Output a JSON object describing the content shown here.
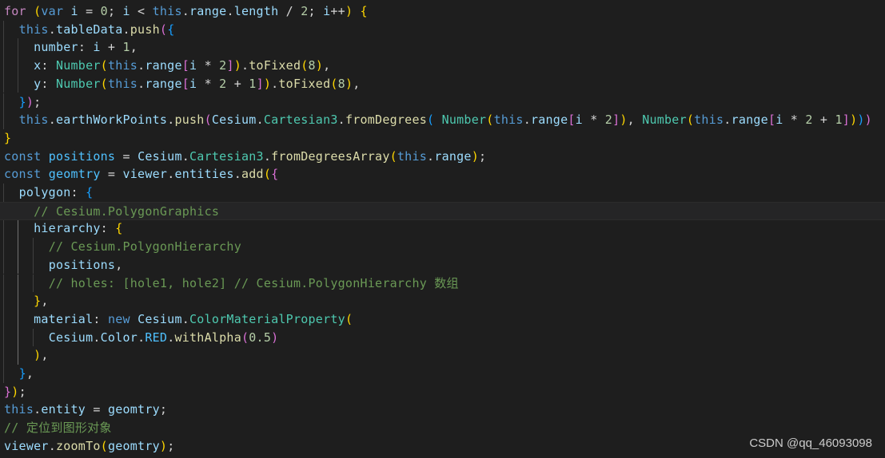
{
  "lines": [
    [
      [
        "for",
        "t-ctrl"
      ],
      [
        " ",
        "t-p"
      ],
      [
        "(",
        "t-b1"
      ],
      [
        "var",
        "t-decl"
      ],
      [
        " ",
        "t-p"
      ],
      [
        "i",
        "t-var"
      ],
      [
        " = ",
        "t-p"
      ],
      [
        "0",
        "t-num"
      ],
      [
        "; ",
        "t-p"
      ],
      [
        "i",
        "t-var"
      ],
      [
        " < ",
        "t-p"
      ],
      [
        "this",
        "t-this"
      ],
      [
        ".",
        "t-p"
      ],
      [
        "range",
        "t-var"
      ],
      [
        ".",
        "t-p"
      ],
      [
        "length",
        "t-var"
      ],
      [
        " / ",
        "t-p"
      ],
      [
        "2",
        "t-num"
      ],
      [
        "; ",
        "t-p"
      ],
      [
        "i",
        "t-var"
      ],
      [
        "++",
        "t-p"
      ],
      [
        ")",
        "t-b1"
      ],
      [
        " ",
        "t-p"
      ],
      [
        "{",
        "t-b1"
      ]
    ],
    [
      [
        "  ",
        "t-p"
      ],
      [
        "this",
        "t-this"
      ],
      [
        ".",
        "t-p"
      ],
      [
        "tableData",
        "t-var"
      ],
      [
        ".",
        "t-p"
      ],
      [
        "push",
        "t-fn"
      ],
      [
        "(",
        "t-b2"
      ],
      [
        "{",
        "t-b3"
      ]
    ],
    [
      [
        "    ",
        "t-p"
      ],
      [
        "number",
        "t-prop"
      ],
      [
        ": ",
        "t-p"
      ],
      [
        "i",
        "t-var"
      ],
      [
        " + ",
        "t-p"
      ],
      [
        "1",
        "t-num"
      ],
      [
        ",",
        "t-p"
      ]
    ],
    [
      [
        "    ",
        "t-p"
      ],
      [
        "x",
        "t-prop"
      ],
      [
        ": ",
        "t-p"
      ],
      [
        "Number",
        "t-cls"
      ],
      [
        "(",
        "t-b1"
      ],
      [
        "this",
        "t-this"
      ],
      [
        ".",
        "t-p"
      ],
      [
        "range",
        "t-var"
      ],
      [
        "[",
        "t-b2"
      ],
      [
        "i",
        "t-var"
      ],
      [
        " * ",
        "t-p"
      ],
      [
        "2",
        "t-num"
      ],
      [
        "]",
        "t-b2"
      ],
      [
        ")",
        "t-b1"
      ],
      [
        ".",
        "t-p"
      ],
      [
        "toFixed",
        "t-fn"
      ],
      [
        "(",
        "t-b1"
      ],
      [
        "8",
        "t-num"
      ],
      [
        ")",
        "t-b1"
      ],
      [
        ",",
        "t-p"
      ]
    ],
    [
      [
        "    ",
        "t-p"
      ],
      [
        "y",
        "t-prop"
      ],
      [
        ": ",
        "t-p"
      ],
      [
        "Number",
        "t-cls"
      ],
      [
        "(",
        "t-b1"
      ],
      [
        "this",
        "t-this"
      ],
      [
        ".",
        "t-p"
      ],
      [
        "range",
        "t-var"
      ],
      [
        "[",
        "t-b2"
      ],
      [
        "i",
        "t-var"
      ],
      [
        " * ",
        "t-p"
      ],
      [
        "2",
        "t-num"
      ],
      [
        " + ",
        "t-p"
      ],
      [
        "1",
        "t-num"
      ],
      [
        "]",
        "t-b2"
      ],
      [
        ")",
        "t-b1"
      ],
      [
        ".",
        "t-p"
      ],
      [
        "toFixed",
        "t-fn"
      ],
      [
        "(",
        "t-b1"
      ],
      [
        "8",
        "t-num"
      ],
      [
        ")",
        "t-b1"
      ],
      [
        ",",
        "t-p"
      ]
    ],
    [
      [
        "  ",
        "t-p"
      ],
      [
        "}",
        "t-b3"
      ],
      [
        ")",
        "t-b2"
      ],
      [
        ";",
        "t-p"
      ]
    ],
    [
      [
        "  ",
        "t-p"
      ],
      [
        "this",
        "t-this"
      ],
      [
        ".",
        "t-p"
      ],
      [
        "earthWorkPoints",
        "t-var"
      ],
      [
        ".",
        "t-p"
      ],
      [
        "push",
        "t-fn"
      ],
      [
        "(",
        "t-b2"
      ],
      [
        "Cesium",
        "t-var"
      ],
      [
        ".",
        "t-p"
      ],
      [
        "Cartesian3",
        "t-cls"
      ],
      [
        ".",
        "t-p"
      ],
      [
        "fromDegrees",
        "t-fn"
      ],
      [
        "(",
        "t-b3"
      ],
      [
        " ",
        "t-p"
      ],
      [
        "Number",
        "t-cls"
      ],
      [
        "(",
        "t-b1"
      ],
      [
        "this",
        "t-this"
      ],
      [
        ".",
        "t-p"
      ],
      [
        "range",
        "t-var"
      ],
      [
        "[",
        "t-b2"
      ],
      [
        "i",
        "t-var"
      ],
      [
        " * ",
        "t-p"
      ],
      [
        "2",
        "t-num"
      ],
      [
        "]",
        "t-b2"
      ],
      [
        ")",
        "t-b1"
      ],
      [
        ", ",
        "t-p"
      ],
      [
        "Number",
        "t-cls"
      ],
      [
        "(",
        "t-b1"
      ],
      [
        "this",
        "t-this"
      ],
      [
        ".",
        "t-p"
      ],
      [
        "range",
        "t-var"
      ],
      [
        "[",
        "t-b2"
      ],
      [
        "i",
        "t-var"
      ],
      [
        " * ",
        "t-p"
      ],
      [
        "2",
        "t-num"
      ],
      [
        " + ",
        "t-p"
      ],
      [
        "1",
        "t-num"
      ],
      [
        "]",
        "t-b2"
      ],
      [
        ")",
        "t-b1"
      ],
      [
        ")",
        "t-b3"
      ],
      [
        ")",
        "t-b2"
      ]
    ],
    [
      [
        "}",
        "t-b1"
      ]
    ],
    [
      [
        "const",
        "t-decl"
      ],
      [
        " ",
        "t-p"
      ],
      [
        "positions",
        "t-const"
      ],
      [
        " = ",
        "t-p"
      ],
      [
        "Cesium",
        "t-var"
      ],
      [
        ".",
        "t-p"
      ],
      [
        "Cartesian3",
        "t-cls"
      ],
      [
        ".",
        "t-p"
      ],
      [
        "fromDegreesArray",
        "t-fn"
      ],
      [
        "(",
        "t-b1"
      ],
      [
        "this",
        "t-this"
      ],
      [
        ".",
        "t-p"
      ],
      [
        "range",
        "t-var"
      ],
      [
        ")",
        "t-b1"
      ],
      [
        ";",
        "t-p"
      ]
    ],
    [
      [
        "const",
        "t-decl"
      ],
      [
        " ",
        "t-p"
      ],
      [
        "geomtry",
        "t-const"
      ],
      [
        " = ",
        "t-p"
      ],
      [
        "viewer",
        "t-var"
      ],
      [
        ".",
        "t-p"
      ],
      [
        "entities",
        "t-var"
      ],
      [
        ".",
        "t-p"
      ],
      [
        "add",
        "t-fn"
      ],
      [
        "(",
        "t-b1"
      ],
      [
        "{",
        "t-b2"
      ]
    ],
    [
      [
        "  ",
        "t-p"
      ],
      [
        "polygon",
        "t-prop"
      ],
      [
        ": ",
        "t-p"
      ],
      [
        "{",
        "t-b3"
      ]
    ],
    [
      [
        "    ",
        "t-p"
      ],
      [
        "// Cesium.PolygonGraphics",
        "t-cmt"
      ]
    ],
    [
      [
        "    ",
        "t-p"
      ],
      [
        "hierarchy",
        "t-prop"
      ],
      [
        ": ",
        "t-p"
      ],
      [
        "{",
        "t-b1"
      ]
    ],
    [
      [
        "      ",
        "t-p"
      ],
      [
        "// Cesium.PolygonHierarchy",
        "t-cmt"
      ]
    ],
    [
      [
        "      ",
        "t-p"
      ],
      [
        "positions",
        "t-var"
      ],
      [
        ",",
        "t-p"
      ]
    ],
    [
      [
        "      ",
        "t-p"
      ],
      [
        "// holes: [hole1, hole2] // Cesium.PolygonHierarchy 数组",
        "t-cmt"
      ]
    ],
    [
      [
        "    ",
        "t-p"
      ],
      [
        "}",
        "t-b1"
      ],
      [
        ",",
        "t-p"
      ]
    ],
    [
      [
        "    ",
        "t-p"
      ],
      [
        "material",
        "t-prop"
      ],
      [
        ": ",
        "t-p"
      ],
      [
        "new",
        "t-decl"
      ],
      [
        " ",
        "t-p"
      ],
      [
        "Cesium",
        "t-var"
      ],
      [
        ".",
        "t-p"
      ],
      [
        "ColorMaterialProperty",
        "t-cls"
      ],
      [
        "(",
        "t-b1"
      ]
    ],
    [
      [
        "      ",
        "t-p"
      ],
      [
        "Cesium",
        "t-var"
      ],
      [
        ".",
        "t-p"
      ],
      [
        "Color",
        "t-var"
      ],
      [
        ".",
        "t-p"
      ],
      [
        "RED",
        "t-const"
      ],
      [
        ".",
        "t-p"
      ],
      [
        "withAlpha",
        "t-fn"
      ],
      [
        "(",
        "t-b2"
      ],
      [
        "0.5",
        "t-num"
      ],
      [
        ")",
        "t-b2"
      ]
    ],
    [
      [
        "    ",
        "t-p"
      ],
      [
        ")",
        "t-b1"
      ],
      [
        ",",
        "t-p"
      ]
    ],
    [
      [
        "  ",
        "t-p"
      ],
      [
        "}",
        "t-b3"
      ],
      [
        ",",
        "t-p"
      ]
    ],
    [
      [
        "}",
        "t-b2"
      ],
      [
        ")",
        "t-b1"
      ],
      [
        ";",
        "t-p"
      ]
    ],
    [
      [
        "this",
        "t-this"
      ],
      [
        ".",
        "t-p"
      ],
      [
        "entity",
        "t-var"
      ],
      [
        " = ",
        "t-p"
      ],
      [
        "geomtry",
        "t-var"
      ],
      [
        ";",
        "t-p"
      ]
    ],
    [
      [
        "// 定位到图形对象",
        "t-cmt"
      ]
    ],
    [
      [
        "viewer",
        "t-var"
      ],
      [
        ".",
        "t-p"
      ],
      [
        "zoomTo",
        "t-fn"
      ],
      [
        "(",
        "t-b1"
      ],
      [
        "geomtry",
        "t-var"
      ],
      [
        ")",
        "t-b1"
      ],
      [
        ";",
        "t-p"
      ]
    ]
  ],
  "watermark": "CSDN @qq_46093098"
}
